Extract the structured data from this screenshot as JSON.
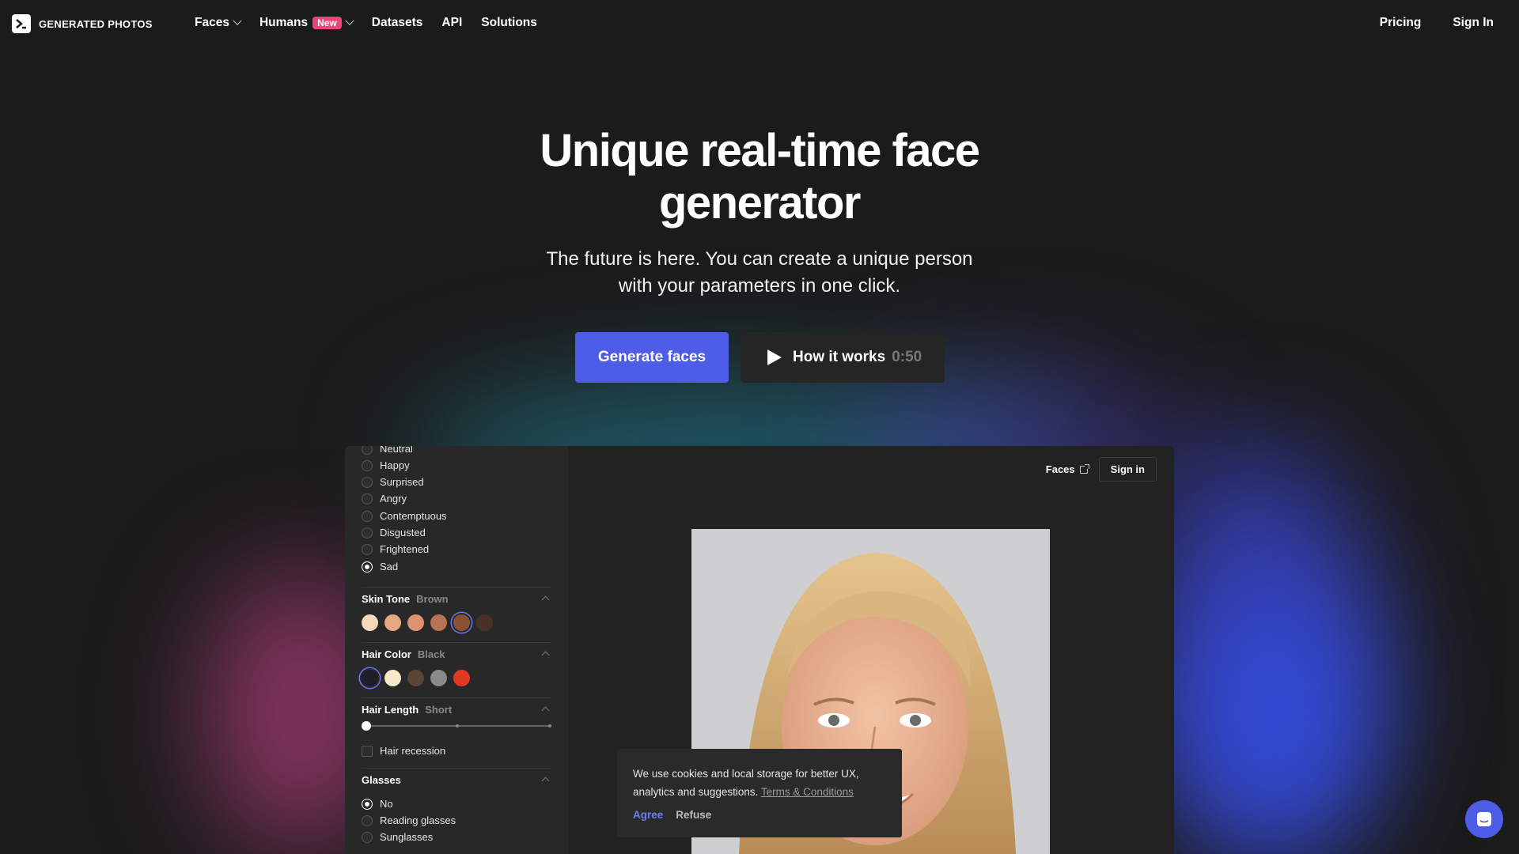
{
  "brand": {
    "name": "GENERATED PHOTOS"
  },
  "nav": {
    "items": [
      {
        "label": "Faces",
        "dropdown": true
      },
      {
        "label": "Humans",
        "badge": "New",
        "dropdown": true
      },
      {
        "label": "Datasets"
      },
      {
        "label": "API"
      },
      {
        "label": "Solutions"
      }
    ],
    "right": [
      {
        "label": "Pricing"
      },
      {
        "label": "Sign In"
      }
    ]
  },
  "hero": {
    "title_line1": "Unique real-time face",
    "title_line2": "generator",
    "subtitle_line1": "The future is here. You can create a unique person",
    "subtitle_line2": "with your parameters in one click.",
    "primary_button": "Generate faces",
    "secondary_button": "How it works",
    "secondary_duration": "0:50"
  },
  "app": {
    "emotions": [
      {
        "label": "Neutral",
        "checked": false
      },
      {
        "label": "Happy",
        "checked": false
      },
      {
        "label": "Surprised",
        "checked": false
      },
      {
        "label": "Angry",
        "checked": false
      },
      {
        "label": "Contemptuous",
        "checked": false
      },
      {
        "label": "Disgusted",
        "checked": false
      },
      {
        "label": "Frightened",
        "checked": false
      },
      {
        "label": "Sad",
        "checked": true
      }
    ],
    "skin_tone": {
      "label": "Skin Tone",
      "value": "Brown",
      "swatches": [
        "#f5d9b8",
        "#e5a886",
        "#de9272",
        "#b87352",
        "#8a5232",
        "#4a3128"
      ],
      "selected_index": 4
    },
    "hair_color": {
      "label": "Hair Color",
      "value": "Black",
      "swatches": [
        "#1f1f2a",
        "#f6e8c9",
        "#5b4536",
        "#8a8a8a",
        "#e23a22"
      ],
      "selected_index": 0
    },
    "hair_length": {
      "label": "Hair Length",
      "value": "Short",
      "level": 0
    },
    "hair_recession": {
      "label": "Hair recession",
      "checked": false
    },
    "glasses": {
      "label": "Glasses",
      "options": [
        {
          "label": "No",
          "checked": true
        },
        {
          "label": "Reading glasses",
          "checked": false
        },
        {
          "label": "Sunglasses",
          "checked": false
        }
      ]
    },
    "top_links": {
      "faces": "Faces",
      "sign_in": "Sign in"
    }
  },
  "cookie": {
    "text_line1": "We use cookies and local storage for better UX,",
    "text_line2": "analytics and suggestions.",
    "link": "Terms & Conditions",
    "agree": "Agree",
    "refuse": "Refuse"
  },
  "colors": {
    "accent": "#4e5de8",
    "badge": "#ef4477",
    "background": "#1b1b1b"
  }
}
